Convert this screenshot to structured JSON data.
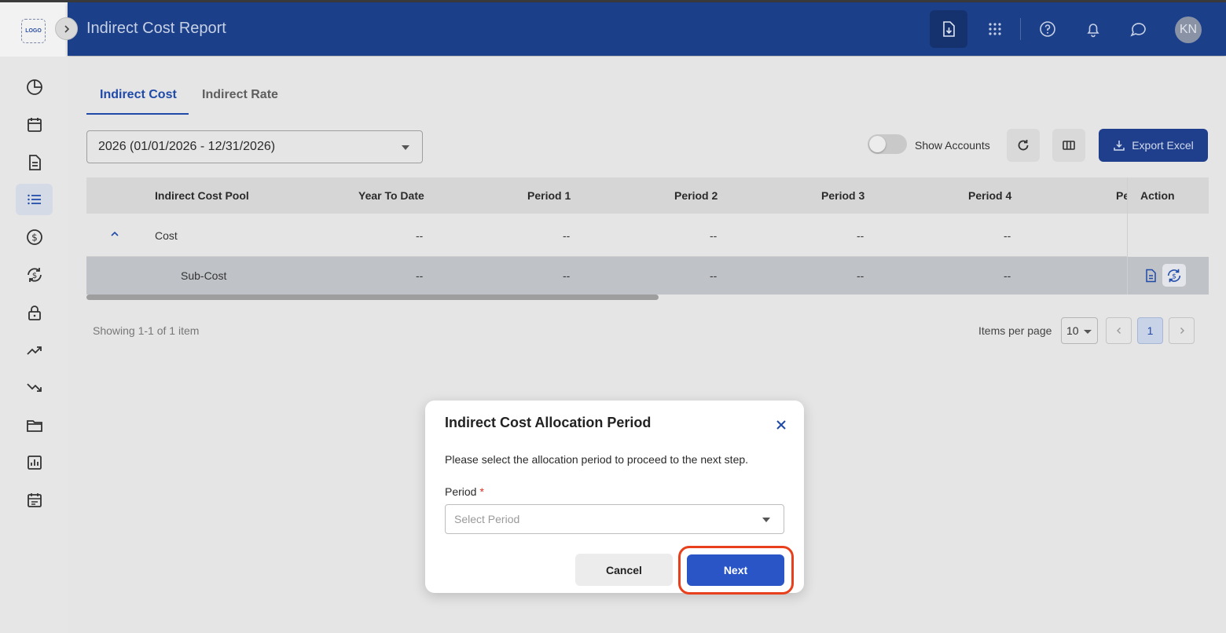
{
  "app": {
    "logo_text": "LOGO",
    "page_title": "Indirect Cost Report",
    "avatar_initials": "KN"
  },
  "header_icons": [
    "download-report-icon",
    "apps-grid-icon",
    "help-icon",
    "bell-icon",
    "chat-icon"
  ],
  "sidebar": {
    "items": [
      "dashboard-icon",
      "calendar-icon",
      "document-icon",
      "list-icon",
      "dollar-icon",
      "currency-sync-icon",
      "lock-icon",
      "trending-up-icon",
      "trending-down-icon",
      "folder-icon",
      "report-chart-icon",
      "schedule-icon"
    ],
    "active_index": 3
  },
  "tabs": [
    {
      "label": "Indirect Cost",
      "active": true
    },
    {
      "label": "Indirect Rate",
      "active": false
    }
  ],
  "filters": {
    "year_select": "2026 (01/01/2026 - 12/31/2026)",
    "show_accounts_label": "Show Accounts",
    "show_accounts_on": false,
    "export_label": "Export Excel"
  },
  "table": {
    "columns": [
      "Indirect Cost Pool",
      "Year To Date",
      "Period 1",
      "Period 2",
      "Period 3",
      "Period 4",
      "Pe",
      "Action"
    ],
    "rows": [
      {
        "name": "Cost",
        "values": [
          "--",
          "--",
          "--",
          "--",
          "--"
        ]
      },
      {
        "name": "Sub-Cost",
        "values": [
          "--",
          "--",
          "--",
          "--",
          "--"
        ]
      }
    ]
  },
  "pagination": {
    "showing": "Showing 1-1 of 1 item",
    "items_per_page_label": "Items per page",
    "items_per_page": "10",
    "current_page": "1"
  },
  "modal": {
    "title": "Indirect Cost Allocation Period",
    "message": "Please select the allocation period to proceed to the next step.",
    "field_label": "Period",
    "required_mark": "*",
    "placeholder": "Select Period",
    "cancel_label": "Cancel",
    "next_label": "Next"
  },
  "colors": {
    "header_bg": "#1c3f8a",
    "accent": "#1f4aa8",
    "primary_button": "#2a55c7",
    "highlight": "#e8401c"
  }
}
